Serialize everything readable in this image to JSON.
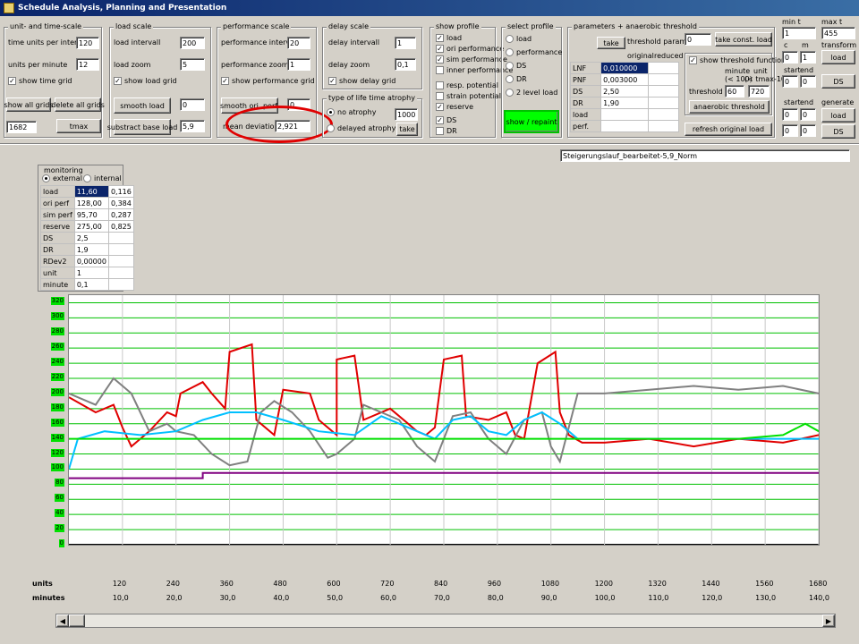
{
  "window": {
    "title": "Schedule Analysis, Planning and Presentation"
  },
  "unit_time": {
    "title": "unit- and time-scale",
    "time_units_label": "time units per intervall",
    "time_units_value": "120",
    "units_per_minute_label": "units per minute",
    "units_per_minute_value": "12",
    "show_time_grid": "show time grid",
    "show_all_grids": "show all grids",
    "delete_all_grids": "delete all grids",
    "total_value": "1682",
    "tmax": "tmax"
  },
  "load_scale": {
    "title": "load scale",
    "interval_label": "load intervall",
    "interval_value": "200",
    "zoom_label": "load zoom",
    "zoom_value": "5",
    "show_grid": "show load grid",
    "smooth": "smooth load",
    "smooth_value": "0",
    "substract": "substract base load",
    "substract_value": "5,9"
  },
  "perf_scale": {
    "title": "performance scale",
    "interval_label": "performance intervall",
    "interval_value": "20",
    "zoom_label": "performance zoom",
    "zoom_value": "1",
    "show_grid": "show performance grid",
    "smooth": "smooth ori. perf.",
    "smooth_value": "0",
    "mean_dev_label": "mean deviation [%]",
    "mean_dev_value": "2,921"
  },
  "delay_scale": {
    "title": "delay scale",
    "interval_label": "delay intervall",
    "interval_value": "1",
    "zoom_label": "delay zoom",
    "zoom_value": "0,1",
    "show_grid": "show delay grid"
  },
  "atrophy": {
    "title": "type of life time atrophy",
    "no_atrophy": "no atrophy",
    "no_atrophy_value": "1000",
    "delayed": "delayed atrophy",
    "take": "take"
  },
  "show_profile": {
    "title": "show profile",
    "items": [
      "load",
      "ori performance",
      "sim performance",
      "inner performance",
      "resp. potential",
      "strain potential",
      "reserve",
      "DS",
      "DR"
    ]
  },
  "select_profile": {
    "title": "select profile",
    "items": [
      "load",
      "performance",
      "DS",
      "DR",
      "2 level load"
    ],
    "show_repaint": "show / repaint"
  },
  "params": {
    "title": "parameters + anaerobic threshold",
    "take": "take",
    "threshold_params": "threshold parameters",
    "original": "original",
    "reduced": "reduced",
    "rows": [
      {
        "name": "LNF",
        "value": "0,010000"
      },
      {
        "name": "PNF",
        "value": "0,003000"
      },
      {
        "name": "DS",
        "value": "2,50"
      },
      {
        "name": "DR",
        "value": "1,90"
      },
      {
        "name": "load",
        "value": ""
      },
      {
        "name": "perf.",
        "value": ""
      }
    ],
    "const_value": "0",
    "take_const_load": "take const. load",
    "show_threshold": "show threshold function",
    "minute_label": "minute",
    "minute_sub": "(< 100)",
    "unit_label": "unit",
    "unit_sub": "(< tmax-10)",
    "threshold_at": "threshold at",
    "threshold_min": "60",
    "threshold_unit": "720",
    "anaerobic": "anaerobic threshold",
    "refresh": "refresh original load"
  },
  "right": {
    "min_t": "min t",
    "max_t": "max t",
    "min_t_value": "1",
    "max_t_value": "455",
    "c": "c",
    "m": "m",
    "transform": "transform",
    "c_value": "0",
    "m_value": "1",
    "load_btn": "load",
    "start": "start",
    "end": "end",
    "s1": "0",
    "e1": "0",
    "ds_btn": "DS",
    "start2": "start",
    "end2": "end",
    "generate": "generate",
    "s2": "0",
    "e2": "0",
    "s3": "0",
    "e3": "0",
    "load_btn2": "load",
    "ds_btn2": "DS"
  },
  "filename": "Steigerungslauf_bearbeitet-5,9_Norm",
  "monitoring": {
    "title": "monitoring",
    "external": "external",
    "internal": "internal",
    "rows": [
      {
        "name": "load",
        "v1": "11,60",
        "v2": "0,116"
      },
      {
        "name": "ori perf",
        "v1": "128,00",
        "v2": "0,384"
      },
      {
        "name": "sim perf",
        "v1": "95,70",
        "v2": "0,287"
      },
      {
        "name": "reserve",
        "v1": "275,00",
        "v2": "0,825"
      },
      {
        "name": "DS",
        "v1": "2,5",
        "v2": ""
      },
      {
        "name": "DR",
        "v1": "1,9",
        "v2": ""
      },
      {
        "name": "RDev2",
        "v1": "0,00000",
        "v2": ""
      },
      {
        "name": "unit",
        "v1": "1",
        "v2": ""
      },
      {
        "name": "minute",
        "v1": "0,1",
        "v2": ""
      }
    ]
  },
  "chart_data": {
    "type": "line",
    "y_ticks": [
      "0",
      "20",
      "40",
      "60",
      "80",
      "100",
      "120",
      "140",
      "160",
      "180",
      "200",
      "220",
      "240",
      "260",
      "280",
      "300",
      "320"
    ],
    "ylim": [
      0,
      330
    ],
    "xlim": [
      0,
      1680
    ],
    "units_label": "units",
    "minutes_label": "minutes",
    "x_units": [
      "120",
      "240",
      "360",
      "480",
      "600",
      "720",
      "840",
      "960",
      "1080",
      "1200",
      "1320",
      "1440",
      "1560",
      "1680"
    ],
    "x_minutes": [
      "10,0",
      "20,0",
      "30,0",
      "40,0",
      "50,0",
      "60,0",
      "70,0",
      "80,0",
      "90,0",
      "100,0",
      "110,0",
      "120,0",
      "130,0",
      "140,0"
    ],
    "series": [
      {
        "color": "#e00000",
        "values": [
          [
            0,
            195
          ],
          [
            60,
            175
          ],
          [
            100,
            185
          ],
          [
            120,
            155
          ],
          [
            140,
            130
          ],
          [
            180,
            150
          ],
          [
            220,
            175
          ],
          [
            240,
            170
          ],
          [
            250,
            200
          ],
          [
            300,
            215
          ],
          [
            320,
            200
          ],
          [
            350,
            180
          ],
          [
            360,
            255
          ],
          [
            410,
            265
          ],
          [
            420,
            165
          ],
          [
            460,
            145
          ],
          [
            480,
            205
          ],
          [
            540,
            200
          ],
          [
            560,
            165
          ],
          [
            600,
            145
          ],
          [
            600,
            245
          ],
          [
            640,
            250
          ],
          [
            660,
            165
          ],
          [
            720,
            180
          ],
          [
            760,
            160
          ],
          [
            780,
            150
          ],
          [
            800,
            145
          ],
          [
            820,
            155
          ],
          [
            840,
            245
          ],
          [
            880,
            250
          ],
          [
            890,
            170
          ],
          [
            940,
            165
          ],
          [
            980,
            175
          ],
          [
            1000,
            145
          ],
          [
            1020,
            140
          ],
          [
            1050,
            240
          ],
          [
            1090,
            255
          ],
          [
            1100,
            175
          ],
          [
            1120,
            145
          ],
          [
            1150,
            135
          ],
          [
            1200,
            135
          ],
          [
            1300,
            140
          ],
          [
            1400,
            130
          ],
          [
            1500,
            140
          ],
          [
            1600,
            135
          ],
          [
            1680,
            145
          ]
        ]
      },
      {
        "color": "#808080",
        "values": [
          [
            0,
            200
          ],
          [
            60,
            185
          ],
          [
            100,
            220
          ],
          [
            140,
            200
          ],
          [
            180,
            150
          ],
          [
            220,
            160
          ],
          [
            240,
            150
          ],
          [
            280,
            145
          ],
          [
            320,
            120
          ],
          [
            360,
            105
          ],
          [
            400,
            110
          ],
          [
            430,
            175
          ],
          [
            460,
            190
          ],
          [
            500,
            175
          ],
          [
            540,
            150
          ],
          [
            580,
            115
          ],
          [
            600,
            120
          ],
          [
            640,
            140
          ],
          [
            660,
            185
          ],
          [
            700,
            175
          ],
          [
            740,
            165
          ],
          [
            780,
            130
          ],
          [
            820,
            110
          ],
          [
            860,
            170
          ],
          [
            900,
            175
          ],
          [
            940,
            140
          ],
          [
            980,
            120
          ],
          [
            1020,
            165
          ],
          [
            1060,
            175
          ],
          [
            1080,
            130
          ],
          [
            1100,
            110
          ],
          [
            1140,
            200
          ],
          [
            1200,
            200
          ],
          [
            1300,
            205
          ],
          [
            1400,
            210
          ],
          [
            1500,
            205
          ],
          [
            1600,
            210
          ],
          [
            1680,
            200
          ]
        ]
      },
      {
        "color": "#00c0ff",
        "values": [
          [
            0,
            100
          ],
          [
            20,
            140
          ],
          [
            80,
            150
          ],
          [
            160,
            145
          ],
          [
            240,
            150
          ],
          [
            300,
            165
          ],
          [
            360,
            175
          ],
          [
            420,
            175
          ],
          [
            480,
            165
          ],
          [
            560,
            150
          ],
          [
            640,
            145
          ],
          [
            700,
            170
          ],
          [
            740,
            160
          ],
          [
            780,
            150
          ],
          [
            820,
            140
          ],
          [
            860,
            165
          ],
          [
            900,
            170
          ],
          [
            940,
            150
          ],
          [
            980,
            145
          ],
          [
            1020,
            165
          ],
          [
            1060,
            175
          ],
          [
            1100,
            160
          ],
          [
            1140,
            140
          ],
          [
            1200,
            140
          ],
          [
            1300,
            140
          ],
          [
            1400,
            140
          ],
          [
            1500,
            140
          ],
          [
            1600,
            140
          ],
          [
            1680,
            140
          ]
        ]
      },
      {
        "color": "#00e000",
        "values": [
          [
            0,
            140
          ],
          [
            200,
            140
          ],
          [
            400,
            140
          ],
          [
            600,
            140
          ],
          [
            800,
            140
          ],
          [
            1000,
            140
          ],
          [
            1140,
            140
          ],
          [
            1300,
            140
          ],
          [
            1500,
            140
          ],
          [
            1600,
            145
          ],
          [
            1650,
            160
          ],
          [
            1680,
            150
          ]
        ]
      },
      {
        "color": "#800080",
        "values": [
          [
            0,
            88
          ],
          [
            300,
            88
          ],
          [
            300,
            95
          ],
          [
            1680,
            95
          ]
        ]
      }
    ]
  }
}
